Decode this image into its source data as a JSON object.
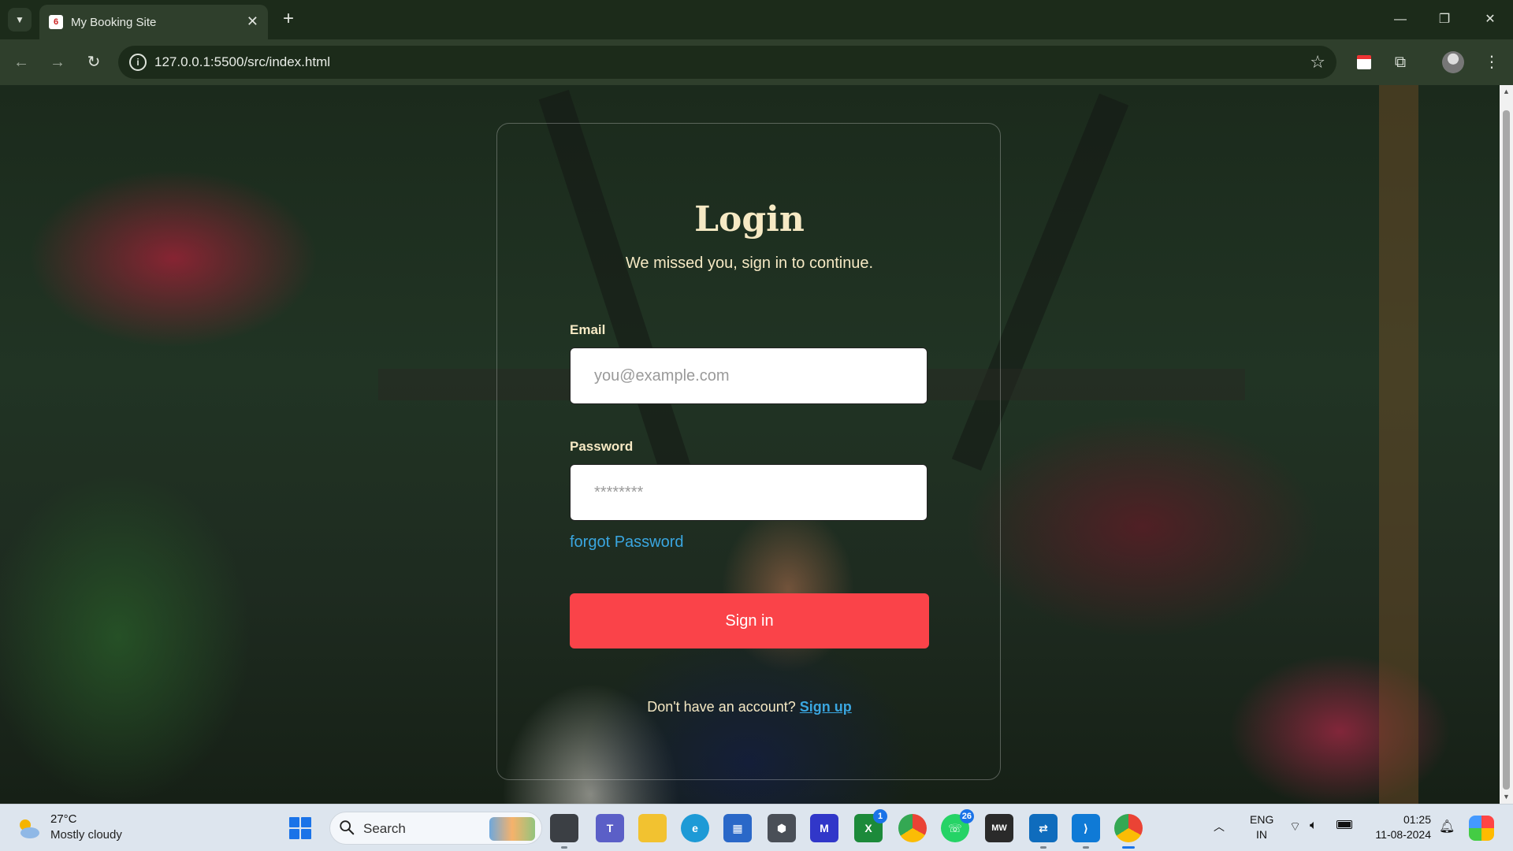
{
  "browser": {
    "tab_title": "My Booking Site",
    "tab_close": "✕",
    "new_tab": "+",
    "url": "127.0.0.1:5500/src/index.html",
    "window_controls": {
      "minimize": "—",
      "restore": "❐",
      "close": "✕"
    }
  },
  "login": {
    "title": "Login",
    "subtitle": "We missed you, sign in to continue.",
    "email_label": "Email",
    "email_placeholder": "you@example.com",
    "email_value": "",
    "password_label": "Password",
    "password_placeholder": "********",
    "password_value": "",
    "forgot_text": "forgot Password",
    "signin_label": "Sign in",
    "signup_prompt": "Don't have an account?",
    "signup_link": "Sign up"
  },
  "colors": {
    "accent": "#fa4349",
    "link": "#3aa6e0",
    "title": "#f6e9c4"
  },
  "taskbar": {
    "weather_temp": "27°C",
    "weather_desc": "Mostly cloudy",
    "search_label": "Search",
    "apps": [
      {
        "name": "task-view",
        "badge": ""
      },
      {
        "name": "teams",
        "badge": ""
      },
      {
        "name": "file-explorer",
        "badge": ""
      },
      {
        "name": "edge",
        "badge": ""
      },
      {
        "name": "store",
        "badge": ""
      },
      {
        "name": "app-cube",
        "badge": ""
      },
      {
        "name": "app-m",
        "badge": ""
      },
      {
        "name": "xbox",
        "badge": "1"
      },
      {
        "name": "chrome",
        "badge": ""
      },
      {
        "name": "whatsapp",
        "badge": "26"
      },
      {
        "name": "mw-app",
        "badge": ""
      },
      {
        "name": "remote-app",
        "badge": ""
      },
      {
        "name": "vscode",
        "badge": ""
      },
      {
        "name": "chrome-active",
        "badge": ""
      }
    ],
    "lang_line1": "ENG",
    "lang_line2": "IN",
    "time": "01:25",
    "date": "11-08-2024"
  }
}
